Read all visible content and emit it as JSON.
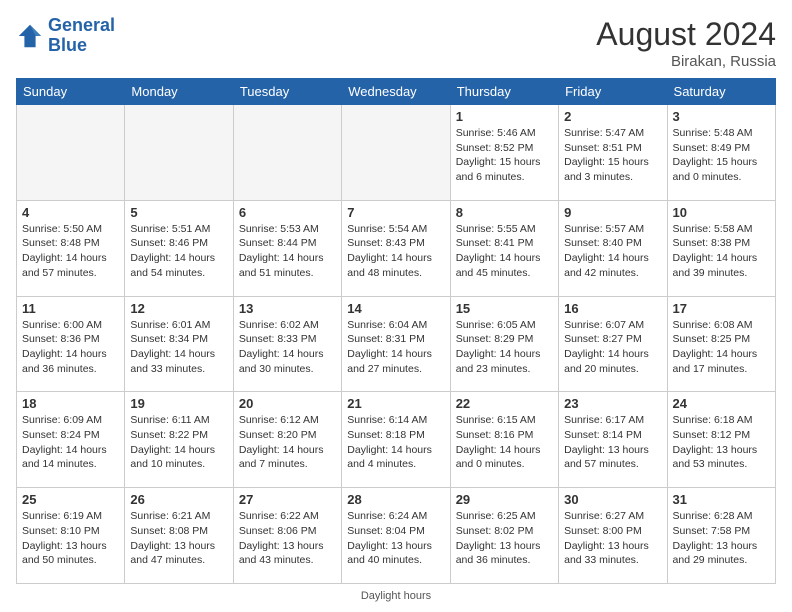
{
  "header": {
    "logo_line1": "General",
    "logo_line2": "Blue",
    "month_year": "August 2024",
    "location": "Birakan, Russia"
  },
  "footer": {
    "text": "Daylight hours"
  },
  "days_of_week": [
    "Sunday",
    "Monday",
    "Tuesday",
    "Wednesday",
    "Thursday",
    "Friday",
    "Saturday"
  ],
  "weeks": [
    [
      {
        "day": "",
        "info": ""
      },
      {
        "day": "",
        "info": ""
      },
      {
        "day": "",
        "info": ""
      },
      {
        "day": "",
        "info": ""
      },
      {
        "day": "1",
        "info": "Sunrise: 5:46 AM\nSunset: 8:52 PM\nDaylight: 15 hours\nand 6 minutes."
      },
      {
        "day": "2",
        "info": "Sunrise: 5:47 AM\nSunset: 8:51 PM\nDaylight: 15 hours\nand 3 minutes."
      },
      {
        "day": "3",
        "info": "Sunrise: 5:48 AM\nSunset: 8:49 PM\nDaylight: 15 hours\nand 0 minutes."
      }
    ],
    [
      {
        "day": "4",
        "info": "Sunrise: 5:50 AM\nSunset: 8:48 PM\nDaylight: 14 hours\nand 57 minutes."
      },
      {
        "day": "5",
        "info": "Sunrise: 5:51 AM\nSunset: 8:46 PM\nDaylight: 14 hours\nand 54 minutes."
      },
      {
        "day": "6",
        "info": "Sunrise: 5:53 AM\nSunset: 8:44 PM\nDaylight: 14 hours\nand 51 minutes."
      },
      {
        "day": "7",
        "info": "Sunrise: 5:54 AM\nSunset: 8:43 PM\nDaylight: 14 hours\nand 48 minutes."
      },
      {
        "day": "8",
        "info": "Sunrise: 5:55 AM\nSunset: 8:41 PM\nDaylight: 14 hours\nand 45 minutes."
      },
      {
        "day": "9",
        "info": "Sunrise: 5:57 AM\nSunset: 8:40 PM\nDaylight: 14 hours\nand 42 minutes."
      },
      {
        "day": "10",
        "info": "Sunrise: 5:58 AM\nSunset: 8:38 PM\nDaylight: 14 hours\nand 39 minutes."
      }
    ],
    [
      {
        "day": "11",
        "info": "Sunrise: 6:00 AM\nSunset: 8:36 PM\nDaylight: 14 hours\nand 36 minutes."
      },
      {
        "day": "12",
        "info": "Sunrise: 6:01 AM\nSunset: 8:34 PM\nDaylight: 14 hours\nand 33 minutes."
      },
      {
        "day": "13",
        "info": "Sunrise: 6:02 AM\nSunset: 8:33 PM\nDaylight: 14 hours\nand 30 minutes."
      },
      {
        "day": "14",
        "info": "Sunrise: 6:04 AM\nSunset: 8:31 PM\nDaylight: 14 hours\nand 27 minutes."
      },
      {
        "day": "15",
        "info": "Sunrise: 6:05 AM\nSunset: 8:29 PM\nDaylight: 14 hours\nand 23 minutes."
      },
      {
        "day": "16",
        "info": "Sunrise: 6:07 AM\nSunset: 8:27 PM\nDaylight: 14 hours\nand 20 minutes."
      },
      {
        "day": "17",
        "info": "Sunrise: 6:08 AM\nSunset: 8:25 PM\nDaylight: 14 hours\nand 17 minutes."
      }
    ],
    [
      {
        "day": "18",
        "info": "Sunrise: 6:09 AM\nSunset: 8:24 PM\nDaylight: 14 hours\nand 14 minutes."
      },
      {
        "day": "19",
        "info": "Sunrise: 6:11 AM\nSunset: 8:22 PM\nDaylight: 14 hours\nand 10 minutes."
      },
      {
        "day": "20",
        "info": "Sunrise: 6:12 AM\nSunset: 8:20 PM\nDaylight: 14 hours\nand 7 minutes."
      },
      {
        "day": "21",
        "info": "Sunrise: 6:14 AM\nSunset: 8:18 PM\nDaylight: 14 hours\nand 4 minutes."
      },
      {
        "day": "22",
        "info": "Sunrise: 6:15 AM\nSunset: 8:16 PM\nDaylight: 14 hours\nand 0 minutes."
      },
      {
        "day": "23",
        "info": "Sunrise: 6:17 AM\nSunset: 8:14 PM\nDaylight: 13 hours\nand 57 minutes."
      },
      {
        "day": "24",
        "info": "Sunrise: 6:18 AM\nSunset: 8:12 PM\nDaylight: 13 hours\nand 53 minutes."
      }
    ],
    [
      {
        "day": "25",
        "info": "Sunrise: 6:19 AM\nSunset: 8:10 PM\nDaylight: 13 hours\nand 50 minutes."
      },
      {
        "day": "26",
        "info": "Sunrise: 6:21 AM\nSunset: 8:08 PM\nDaylight: 13 hours\nand 47 minutes."
      },
      {
        "day": "27",
        "info": "Sunrise: 6:22 AM\nSunset: 8:06 PM\nDaylight: 13 hours\nand 43 minutes."
      },
      {
        "day": "28",
        "info": "Sunrise: 6:24 AM\nSunset: 8:04 PM\nDaylight: 13 hours\nand 40 minutes."
      },
      {
        "day": "29",
        "info": "Sunrise: 6:25 AM\nSunset: 8:02 PM\nDaylight: 13 hours\nand 36 minutes."
      },
      {
        "day": "30",
        "info": "Sunrise: 6:27 AM\nSunset: 8:00 PM\nDaylight: 13 hours\nand 33 minutes."
      },
      {
        "day": "31",
        "info": "Sunrise: 6:28 AM\nSunset: 7:58 PM\nDaylight: 13 hours\nand 29 minutes."
      }
    ]
  ]
}
